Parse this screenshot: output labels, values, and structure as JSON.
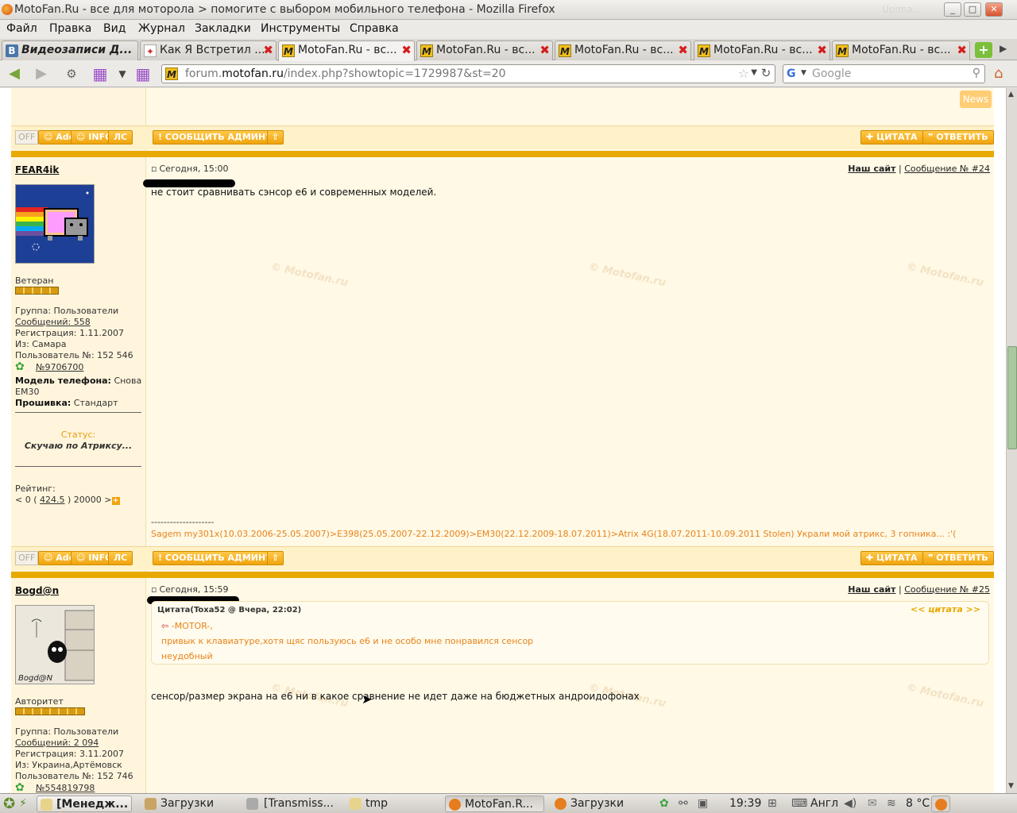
{
  "window": {
    "title": "MotoFan.Ru - все для моторола > помогите с выбором мобильного телефона - Mozilla Firefox",
    "controls": [
      "_",
      "□",
      "✕"
    ],
    "bg_label": "Upima..."
  },
  "menu": [
    "Файл",
    "Правка",
    "Вид",
    "Журнал",
    "Закладки",
    "Инструменты",
    "Справка"
  ],
  "tabs": [
    {
      "label": "Видеозаписи Д...",
      "icon": "В"
    },
    {
      "label": "Как Я Встретил ...",
      "icon": "✦"
    },
    {
      "label": "MotoFan.Ru - вс...",
      "icon": "M"
    },
    {
      "label": "MotoFan.Ru - вс...",
      "icon": "M"
    },
    {
      "label": "MotoFan.Ru - вс...",
      "icon": "M"
    },
    {
      "label": "MotoFan.Ru - вс...",
      "icon": "M"
    },
    {
      "label": "MotoFan.Ru - вс...",
      "icon": "M"
    }
  ],
  "nav": {
    "url_prefix": "forum.",
    "url_domain": "motofan.ru",
    "url_rest": "/index.php?showtopic=1729987&st=20",
    "search_placeholder": "Google",
    "url_icon": "M",
    "search_icon": "G"
  },
  "forum": {
    "news_label": "News",
    "buttons": {
      "off": "OFF",
      "add": "Add",
      "info": "INFO",
      "pm": "ЛС",
      "report": "СООБЩИТЬ АДМИНУ",
      "quote": "ЦИТАТА",
      "reply": "ОТВЕТИТЬ",
      "up": "⇧"
    },
    "post1": {
      "author": "FEAR4ik",
      "date": "Сегодня, 15:00",
      "site_link": "Наш сайт",
      "sep": "|",
      "msg_num": "Сообщение № #24",
      "text": "не стоит сравнивать сэнсор е6 и современных моделей.",
      "rank": "Ветеран",
      "pips": 5,
      "group": "Группа: Пользователи",
      "posts": "Сообщений: 558",
      "reg": "Регистрация: 1.11.2007",
      "from": "Из: Самара",
      "user_no": "Пользователь №: 152 546",
      "icq": "№9706700",
      "phone_label": "Модель телефона:",
      "phone_val": "Снова",
      "phone_val2": "EM30",
      "fw_label": "Прошивка:",
      "fw_val": "Стандарт",
      "status_label": "Статус:",
      "status_val": "Скучаю по Атриксу...",
      "rating_label": "Рейтинг:",
      "rating_pre": "< 0 (",
      "rating_val": "424.5",
      "rating_post": ") 20000 >",
      "rating_plus": "+",
      "sig_sep": "--------------------",
      "sig": "Sagem my301x(10.03.2006-25.05.2007)>E398(25.05.2007-22.12.2009)>EM30(22.12.2009-18.07.2011)>Atrix 4G(18.07.2011-10.09.2011 Stolen) Украли мой атрикс, 3 гопника... :'("
    },
    "post2": {
      "author": "Bogd@n",
      "date": "Сегодня, 15:59",
      "site_link": "Наш сайт",
      "sep": "|",
      "msg_num": "Сообщение № #25",
      "quote_head": "Цитата(Toxa52 @ Вчера, 22:02)",
      "quote_link": "<< цитата >>",
      "quote_lines": [
        "-MOTOR-,",
        "привык к клавиатуре,хотя щяс пользуюсь е6 и не особо мне понравился сенсор",
        "неудобный"
      ],
      "text": "сенсор/размер экрана на е6 ни в какое сравнение не идет даже на бюджетных андроидофонах",
      "avatar_caption": "Bogd@N",
      "rank": "Авторитет",
      "pips": 9,
      "group": "Группа: Пользователи",
      "posts": "Сообщений: 2 094",
      "reg": "Регистрация: 3.11.2007",
      "from": "Из: Украина,Артёмовск",
      "user_no": "Пользователь №: 152 746",
      "icq": "№554819798"
    },
    "watermark": "© Motofan.ru"
  },
  "taskbar": {
    "items": [
      "[Менедж...",
      "Загрузки",
      "[Transmiss...",
      "tmp",
      "MotoFan.R...",
      "Загрузки"
    ],
    "clock": "19:39",
    "layout": "Англ",
    "temp": "8 °C"
  }
}
